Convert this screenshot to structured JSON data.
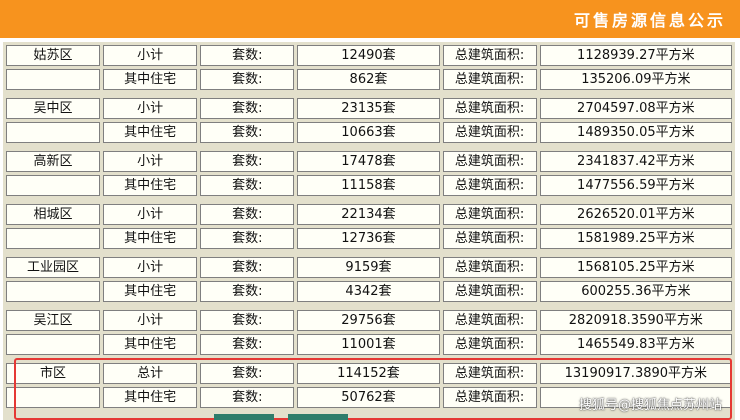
{
  "header": {
    "title": "可售房源信息公示"
  },
  "labels": {
    "count": "套数:",
    "area": "总建筑面积:"
  },
  "districts": [
    {
      "name": "姑苏区",
      "total_label": "小计",
      "total_count": "12490套",
      "total_area": "1128939.27平方米",
      "res_label": "其中住宅",
      "res_count": "862套",
      "res_area": "135206.09平方米"
    },
    {
      "name": "吴中区",
      "total_label": "小计",
      "total_count": "23135套",
      "total_area": "2704597.08平方米",
      "res_label": "其中住宅",
      "res_count": "10663套",
      "res_area": "1489350.05平方米"
    },
    {
      "name": "高新区",
      "total_label": "小计",
      "total_count": "17478套",
      "total_area": "2341837.42平方米",
      "res_label": "其中住宅",
      "res_count": "11158套",
      "res_area": "1477556.59平方米"
    },
    {
      "name": "相城区",
      "total_label": "小计",
      "total_count": "22134套",
      "total_area": "2626520.01平方米",
      "res_label": "其中住宅",
      "res_count": "12736套",
      "res_area": "1581989.25平方米"
    },
    {
      "name": "工业园区",
      "total_label": "小计",
      "total_count": "9159套",
      "total_area": "1568105.25平方米",
      "res_label": "其中住宅",
      "res_count": "4342套",
      "res_area": "600255.36平方米"
    },
    {
      "name": "吴江区",
      "total_label": "小计",
      "total_count": "29756套",
      "total_area": "2820918.3590平方米",
      "res_label": "其中住宅",
      "res_count": "11001套",
      "res_area": "1465549.83平方米"
    },
    {
      "name": "市区",
      "total_label": "总计",
      "total_count": "114152套",
      "total_area": "13190917.3890平方米",
      "res_label": "其中住宅",
      "res_count": "50762套",
      "res_area": ""
    }
  ],
  "watermark": "搜狐号@搜狐焦点苏州站",
  "colors": {
    "header": "#f7931e",
    "highlight": "#e53935",
    "table_bg": "#e3e0cc",
    "cell_bg": "#fffff7"
  }
}
